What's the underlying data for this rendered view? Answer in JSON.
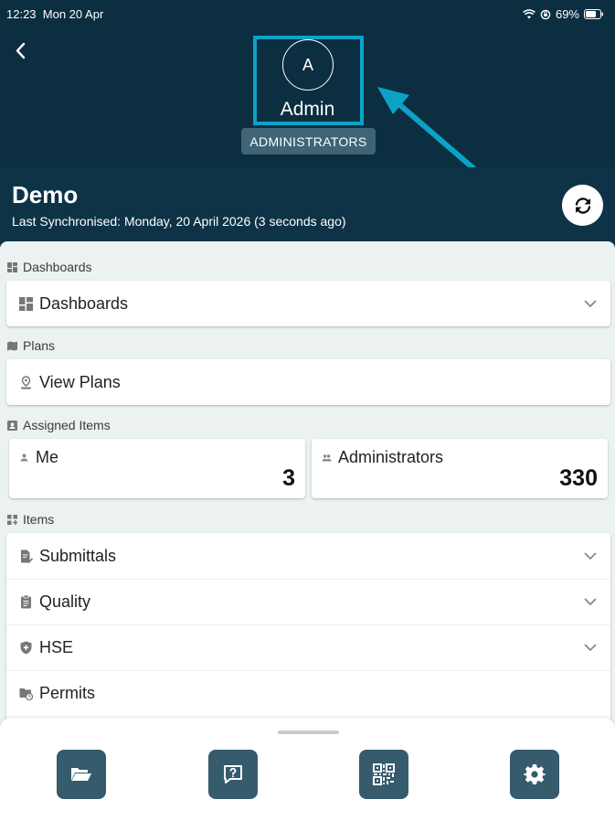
{
  "status_bar": {
    "time": "12:23",
    "date": "Mon 20 Apr",
    "battery": "69%"
  },
  "user": {
    "initial": "A",
    "name": "Admin",
    "role": "ADMINISTRATORS"
  },
  "project": {
    "name": "Demo",
    "sync_text": "Last Synchronised: Monday, 20 April 2026 (3 seconds ago)"
  },
  "sections": {
    "dashboards": {
      "label": "Dashboards",
      "item": "Dashboards"
    },
    "plans": {
      "label": "Plans",
      "item": "View Plans"
    },
    "assigned": {
      "label": "Assigned Items",
      "me": {
        "label": "Me",
        "count": "3"
      },
      "group": {
        "label": "Administrators",
        "count": "330"
      }
    },
    "items": {
      "label": "Items",
      "list": [
        "Submittals",
        "Quality",
        "HSE",
        "Permits"
      ]
    }
  },
  "colors": {
    "header": "#0c2e41",
    "highlight": "#0aa3c6",
    "button": "#355b6d"
  },
  "toolbar": {
    "icons": [
      "folder-icon",
      "help-chat-icon",
      "qr-code-icon",
      "gear-icon"
    ]
  }
}
